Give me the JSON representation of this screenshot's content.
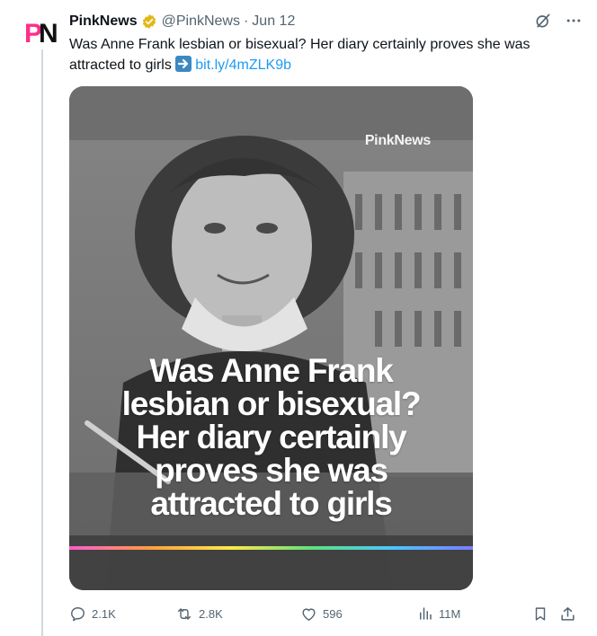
{
  "author": {
    "name": "PinkNews",
    "handle": "@PinkNews",
    "separator": "·",
    "date": "Jun 12",
    "avatar_text": "PN"
  },
  "tweet": {
    "text": "Was Anne Frank lesbian or bisexual? Her diary certainly proves she was attracted to girls",
    "emoji": "arrow-right-emoji",
    "link": "bit.ly/4mZLK9b"
  },
  "media": {
    "brand": "PinkNews",
    "headline_lines": [
      "Was Anne Frank",
      "lesbian or bisexual?",
      "Her diary certainly",
      "proves she was",
      "attracted to girls"
    ]
  },
  "actions": {
    "replies": "2.1K",
    "reposts": "2.8K",
    "likes": "596",
    "views": "11M"
  },
  "colors": {
    "link": "#1d9bf0",
    "muted": "#536471",
    "badge_gold": "#e2b719",
    "brand_pink": "#ff2d8a"
  }
}
